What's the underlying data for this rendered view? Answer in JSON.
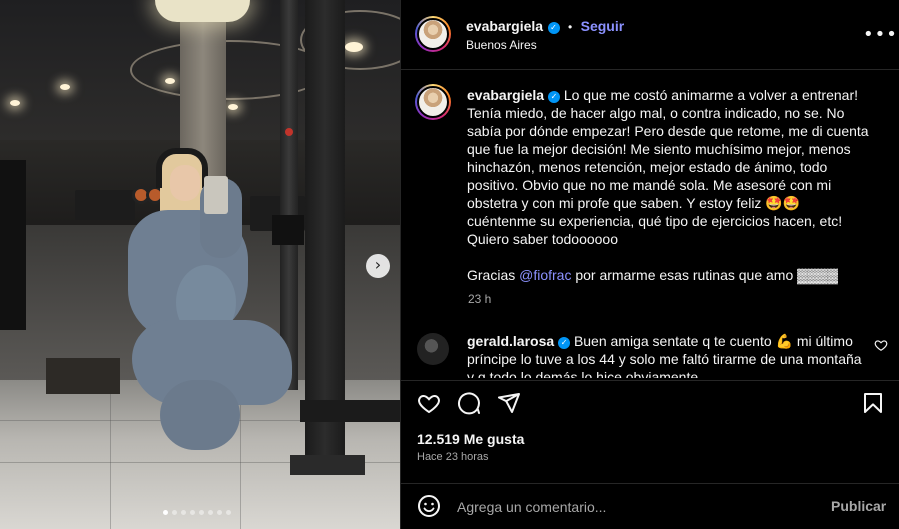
{
  "post": {
    "username": "evabargiela",
    "follow_label": "Seguir",
    "dot_separator": "•",
    "location": "Buenos Aires",
    "more_label": "•••",
    "carousel_next": "›",
    "carousel_pages": 8,
    "carousel_active": 1
  },
  "caption": {
    "username": "evabargiela",
    "text": "Lo que me costó animarme a volver a entrenar! Tenía miedo, de hacer algo mal, o contra indicado, no se. No sabía por dónde empezar! Pero desde que retome, me di cuenta que fue la mejor decisión! Me siento muchísimo mejor, menos hinchazón, menos retención, mejor estado de ánimo, todo positivo. Obvio que no me mandé sola. Me asesoré con mi obstetra y con mi profe que saben. Y estoy feliz 🤩🤩 cuéntenme su experiencia, qué tipo de ejercicios hacen, etc! Quiero saber todoooooo",
    "thanks_prefix": "Gracias ",
    "mention": "@fiofrac",
    "thanks_suffix": " por armarme esas rutinas que amo ▓▓▓▓",
    "time": "23 h"
  },
  "comment": {
    "username": "gerald.larosa",
    "text": "Buen amiga sentate q te cuento 💪 mi último príncipe lo tuve a los 44 y solo me faltó tirarme de una montaña y q todo lo demás lo hice obviamente"
  },
  "actions": {
    "likes": "12.519 Me gusta",
    "when": "Hace 23 horas"
  },
  "add_comment": {
    "placeholder": "Agrega un comentario...",
    "publish_label": "Publicar"
  },
  "colors": {
    "accent": "#8c92ff",
    "verified": "#0095f6",
    "muted": "#a8a8a8",
    "background": "#000000"
  },
  "icons": [
    "verified-badge-icon",
    "more-options-icon",
    "heart-icon",
    "comment-icon",
    "share-icon",
    "bookmark-icon",
    "emoji-icon",
    "chevron-right-icon"
  ]
}
